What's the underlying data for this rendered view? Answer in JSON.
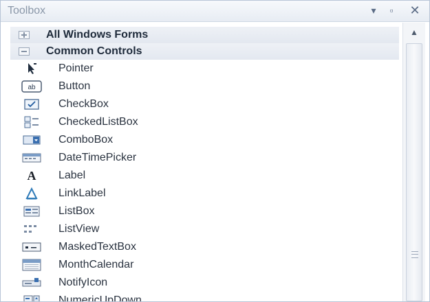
{
  "window": {
    "title": "Toolbox"
  },
  "titlebar_buttons": [
    {
      "icon": "pin-icon",
      "glyph": "▾"
    },
    {
      "icon": "restore-icon",
      "glyph": "▫"
    },
    {
      "icon": "close-icon",
      "glyph": "✕"
    }
  ],
  "groups": [
    {
      "label": "All Windows Forms",
      "state": "collapsed"
    },
    {
      "label": "Common Controls",
      "state": "expanded"
    }
  ],
  "items": [
    {
      "label": "Pointer",
      "icon": "pointer-icon"
    },
    {
      "label": "Button",
      "icon": "button-icon"
    },
    {
      "label": "CheckBox",
      "icon": "checkbox-icon"
    },
    {
      "label": "CheckedListBox",
      "icon": "checkedlistbox-icon"
    },
    {
      "label": "ComboBox",
      "icon": "combobox-icon"
    },
    {
      "label": "DateTimePicker",
      "icon": "datetimepicker-icon"
    },
    {
      "label": "Label",
      "icon": "label-icon"
    },
    {
      "label": "LinkLabel",
      "icon": "linklabel-icon"
    },
    {
      "label": "ListBox",
      "icon": "listbox-icon"
    },
    {
      "label": "ListView",
      "icon": "listview-icon"
    },
    {
      "label": "MaskedTextBox",
      "icon": "maskedtextbox-icon"
    },
    {
      "label": "MonthCalendar",
      "icon": "monthcalendar-icon"
    },
    {
      "label": "NotifyIcon",
      "icon": "notifyicon-icon"
    },
    {
      "label": "NumericUpDown",
      "icon": "numericupdown-icon"
    }
  ],
  "icon_samples": {
    "button": "ab",
    "label": "A"
  },
  "colors": {
    "accent": "#3a7bd5",
    "icon_blue": "#2f6db5",
    "text": "#2a3340"
  }
}
